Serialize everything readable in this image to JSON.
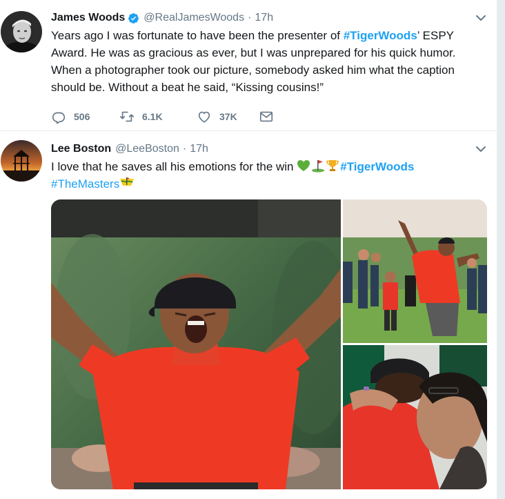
{
  "tweets": [
    {
      "name": "James Woods",
      "handle": "@RealJamesWoods",
      "time": "17h",
      "separator": "·",
      "text_parts": {
        "p1": "Years ago I was fortunate to have been the presenter of ",
        "tag": "#TigerWoods",
        "p2": "’ ESPY Award. He was as gracious as ever, but I was unprepared for his quick humor. When a photographer took our picture, somebody asked him what the caption should be. Without a beat he said, “Kissing cousins!”"
      },
      "replies": "506",
      "retweets": "6.1K",
      "likes": "37K"
    },
    {
      "name": "Lee Boston",
      "handle": "@LeeBoston",
      "time": "17h",
      "separator": "·",
      "text_parts": {
        "p1": "I love that he saves all his emotions for the win ",
        "tag1": "#TigerWoods",
        "tag2": "#TheMasters"
      }
    }
  ],
  "icons": {
    "verified": "verified-badge-icon",
    "caret": "chevron-down-icon",
    "reply": "reply-icon",
    "retweet": "retweet-icon",
    "like": "heart-icon",
    "dm": "envelope-icon",
    "emojis": [
      "green-heart-emoji",
      "golf-flag-emoji",
      "trophy-emoji",
      "masters-badge-emoji"
    ]
  },
  "colors": {
    "link": "#1da1f2",
    "text": "#14171a",
    "muted": "#657786",
    "divider": "#e6ecf0"
  }
}
